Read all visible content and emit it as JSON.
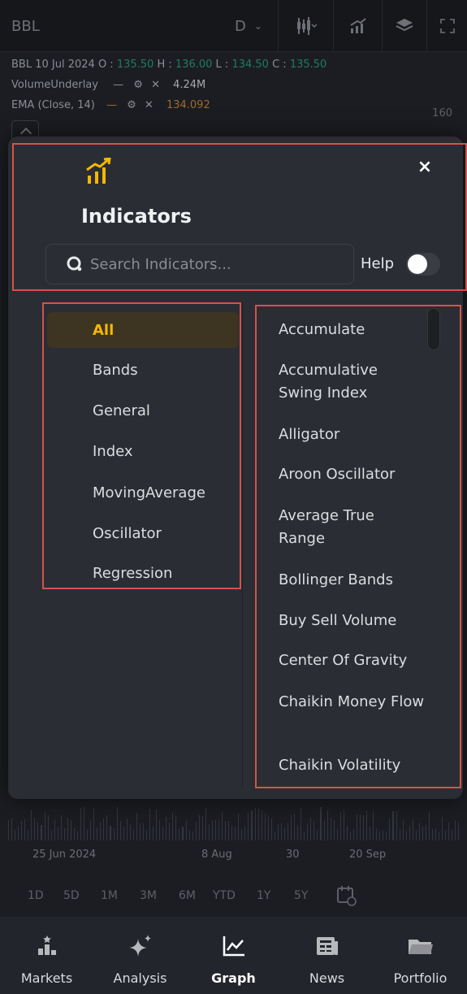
{
  "chart": {
    "symbol": "BBL",
    "interval": "D",
    "legend_ohlc_prefix": "BBL   10 Jul 2024",
    "o_label": "O :",
    "o_value": "135.50",
    "h_label": "H :",
    "h_value": "136.00",
    "l_label": "L :",
    "l_value": "134.50",
    "c_label": "C :",
    "c_value": "135.50",
    "volume_name": "VolumeUnderlay",
    "volume_value": "4.24M",
    "ema_name": "EMA (Close, 14)",
    "ema_value": "134.092",
    "price_tick": "160",
    "x_labels": [
      "25 Jun 2024",
      "8 Aug",
      "30",
      "20 Sep"
    ],
    "ranges": [
      "1D",
      "5D",
      "1M",
      "3M",
      "6M",
      "YTD",
      "1Y",
      "5Y"
    ]
  },
  "modal": {
    "title": "Indicators",
    "close": "×",
    "search_placeholder": "Search Indicators...",
    "help_label": "Help",
    "help_toggle_on": false,
    "categories": [
      {
        "label": "All",
        "active": true
      },
      {
        "label": "Bands",
        "active": false
      },
      {
        "label": "General",
        "active": false
      },
      {
        "label": "Index",
        "active": false
      },
      {
        "label": "MovingAverage",
        "active": false
      },
      {
        "label": "Oscillator",
        "active": false
      },
      {
        "label": "Regression",
        "active": false
      }
    ],
    "indicators": [
      "Accumulate",
      "Accumulative Swing Index",
      "Alligator",
      "Aroon Oscillator",
      "Average True Range",
      "Bollinger Bands",
      "Buy Sell Volume",
      "Center Of Gravity",
      "Chaikin Money Flow",
      "Chaikin Volatility"
    ]
  },
  "nav": {
    "items": [
      {
        "label": "Markets",
        "icon": "markets-icon"
      },
      {
        "label": "Analysis",
        "icon": "analysis-icon"
      },
      {
        "label": "Graph",
        "icon": "graph-icon"
      },
      {
        "label": "News",
        "icon": "news-icon"
      },
      {
        "label": "Portfolio",
        "icon": "portfolio-icon"
      }
    ]
  },
  "colors": {
    "accent": "#f5b700",
    "highlight_border": "#d5524d",
    "modal_bg": "#2a2d33"
  }
}
